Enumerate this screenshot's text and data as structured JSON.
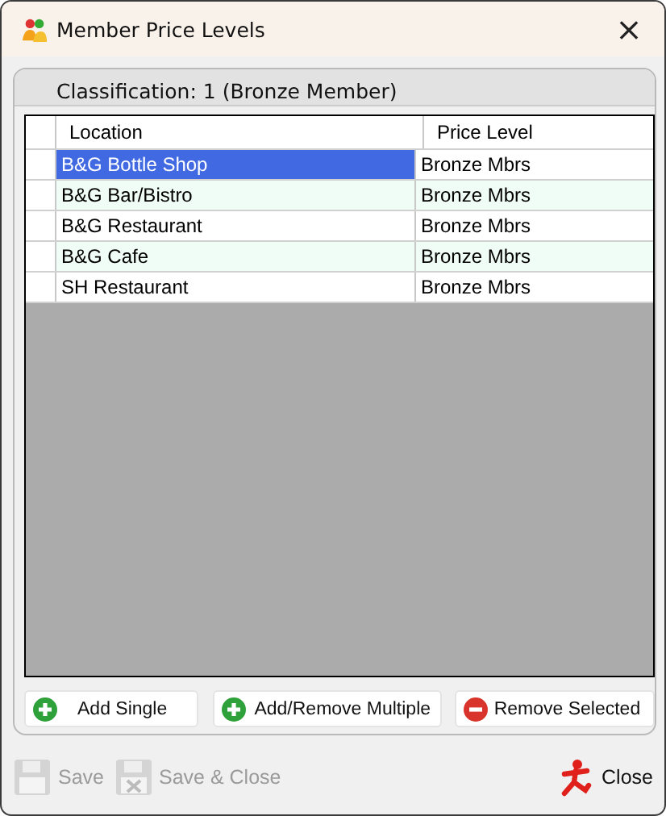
{
  "window": {
    "title": "Member Price Levels",
    "close": "×"
  },
  "classification": "Classification: 1 (Bronze Member)",
  "table": {
    "columns": [
      "Location",
      "Price Level"
    ],
    "rows": [
      {
        "location": "B&G Bottle Shop",
        "price_level": "Bronze Mbrs",
        "selected": true
      },
      {
        "location": "B&G Bar/Bistro",
        "price_level": "Bronze Mbrs",
        "selected": false
      },
      {
        "location": "B&G Restaurant",
        "price_level": "Bronze Mbrs",
        "selected": false
      },
      {
        "location": "B&G Cafe",
        "price_level": "Bronze Mbrs",
        "selected": false
      },
      {
        "location": "SH Restaurant",
        "price_level": "Bronze Mbrs",
        "selected": false
      }
    ]
  },
  "actions": [
    {
      "label": "Add Single",
      "kind": "add"
    },
    {
      "label": "Add/Remove Multiple",
      "kind": "add"
    },
    {
      "label": "Remove Selected",
      "kind": "remove"
    }
  ],
  "footer": [
    {
      "label": "Save",
      "kind": "save",
      "disabled": true
    },
    {
      "label": "Save & Close",
      "kind": "save-close",
      "disabled": true
    },
    {
      "label": "Close",
      "kind": "close",
      "disabled": false
    }
  ]
}
